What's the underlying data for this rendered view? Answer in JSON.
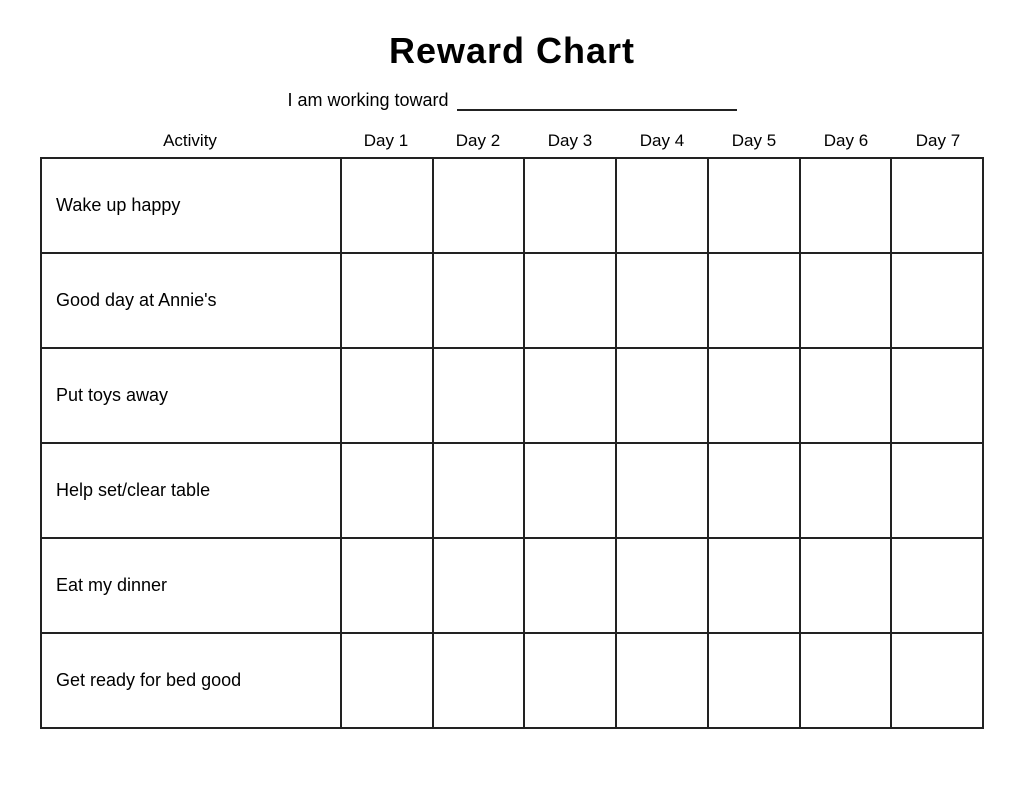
{
  "title": "Reward Chart",
  "goal_label": "I am working toward",
  "headers": {
    "activity": "Activity",
    "days": [
      "Day 1",
      "Day 2",
      "Day 3",
      "Day 4",
      "Day 5",
      "Day 6",
      "Day 7"
    ]
  },
  "activities": [
    "Wake up happy",
    "Good day at Annie's",
    "Put toys away",
    "Help set/clear table",
    "Eat my dinner",
    "Get ready for bed good"
  ]
}
